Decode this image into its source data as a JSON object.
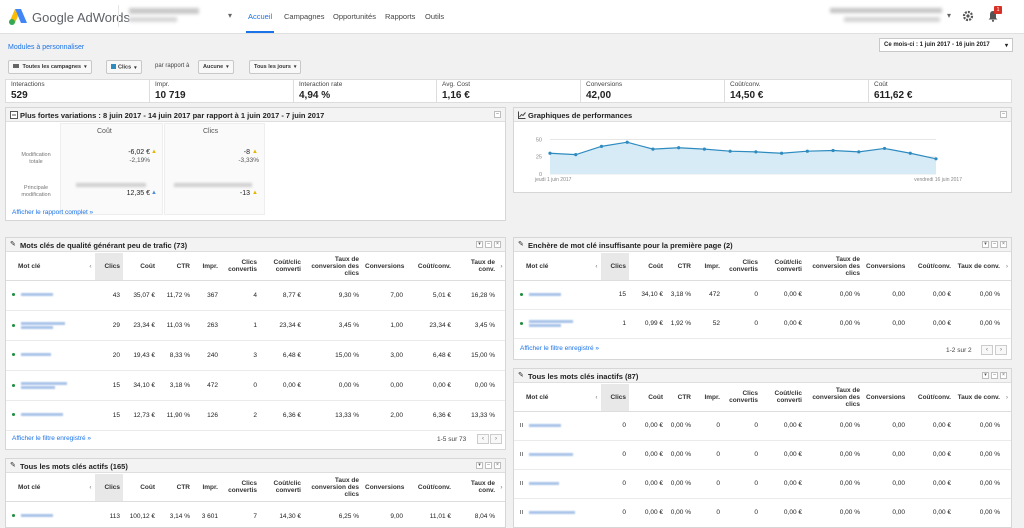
{
  "nav": {
    "brand": "Google AdWords",
    "tabs": [
      "Accueil",
      "Campagnes",
      "Opportunités",
      "Rapports",
      "Outils"
    ],
    "notification_count": "1"
  },
  "toolbar": {
    "modules_link": "Modules à personnaliser",
    "date_range": "Ce mois-ci : 1 juin 2017 - 16 juin 2017",
    "campaigns_filter": "Toutes les campagnes",
    "metric_filter": "Clics",
    "compare_label": "par rapport à",
    "compare_value": "Aucune",
    "days_filter": "Tous les jours"
  },
  "metrics": [
    {
      "label": "Interactions",
      "value": "529"
    },
    {
      "label": "Impr.",
      "value": "10 719"
    },
    {
      "label": "Interaction rate",
      "value": "4,94 %"
    },
    {
      "label": "Avg. Cost",
      "value": "1,16 €"
    },
    {
      "label": "Conversions",
      "value": "42,00"
    },
    {
      "label": "Coût/conv.",
      "value": "14,50 €"
    },
    {
      "label": "Coût",
      "value": "611,62 €"
    }
  ],
  "variations": {
    "title": "Plus fortes variations : 8 juin 2017 - 14 juin 2017 par rapport à 1 juin 2017 - 7 juin 2017",
    "col_cout": "Coût",
    "col_clics": "Clics",
    "row_total": "Modification totale",
    "row_main": "Principale modification",
    "cout_change": "-6,02 €",
    "cout_pct": "-2,19%",
    "clics_change": "-8",
    "clics_pct": "-3,33%",
    "cout_main": "12,35 €",
    "clics_main": "-13",
    "footer_link": "Afficher le rapport complet »"
  },
  "performance": {
    "title": "Graphiques de performances",
    "y_ticks": [
      "50",
      "25",
      "0"
    ],
    "x_start": "jeudi 1 juin 2017",
    "x_end": "vendredi 16 juin 2017"
  },
  "chart_data": {
    "type": "area",
    "title": "Graphiques de performances",
    "x": [
      "1 juin 2017",
      "2 juin 2017",
      "3 juin 2017",
      "4 juin 2017",
      "5 juin 2017",
      "6 juin 2017",
      "7 juin 2017",
      "8 juin 2017",
      "9 juin 2017",
      "10 juin 2017",
      "11 juin 2017",
      "12 juin 2017",
      "13 juin 2017",
      "14 juin 2017",
      "15 juin 2017",
      "16 juin 2017"
    ],
    "series": [
      {
        "values": [
          30,
          28,
          40,
          46,
          36,
          38,
          36,
          33,
          32,
          30,
          33,
          34,
          32,
          37,
          30,
          22
        ]
      }
    ],
    "ylim": [
      0,
      55
    ],
    "y_ticks": [
      0,
      25,
      50
    ],
    "grid": true
  },
  "table_headers": {
    "keyword": "Mot clé",
    "clics": "Clics",
    "cout": "Coût",
    "ctr": "CTR",
    "impr": "Impr.",
    "clics_convertis": "Clics convertis",
    "cout_clic_converti": "Coût/clic converti",
    "taux_conv_clics": "Taux de conversion des clics",
    "conversions": "Conversions",
    "cout_conv": "Coût/conv.",
    "taux_conv": "Taux de conv."
  },
  "quality": {
    "title": "Mots clés de qualité générant peu de trafic (73)",
    "rows": [
      [
        "43",
        "35,07 €",
        "11,72 %",
        "367",
        "4",
        "8,77 €",
        "9,30 %",
        "7,00",
        "5,01 €",
        "16,28 %"
      ],
      [
        "29",
        "23,34 €",
        "11,03 %",
        "263",
        "1",
        "23,34 €",
        "3,45 %",
        "1,00",
        "23,34 €",
        "3,45 %"
      ],
      [
        "20",
        "19,43 €",
        "8,33 %",
        "240",
        "3",
        "6,48 €",
        "15,00 %",
        "3,00",
        "6,48 €",
        "15,00 %"
      ],
      [
        "15",
        "34,10 €",
        "3,18 %",
        "472",
        "0",
        "0,00 €",
        "0,00 %",
        "0,00",
        "0,00 €",
        "0,00 %"
      ],
      [
        "15",
        "12,73 €",
        "11,90 %",
        "126",
        "2",
        "6,36 €",
        "13,33 %",
        "2,00",
        "6,36 €",
        "13,33 %"
      ]
    ],
    "footer_link": "Afficher le filtre enregistré »",
    "pager": "1-5 sur 73"
  },
  "active": {
    "title": "Tous les mots clés actifs (165)",
    "rows": [
      [
        "113",
        "100,12 €",
        "3,14 %",
        "3 601",
        "7",
        "14,30 €",
        "6,25 %",
        "9,00",
        "11,01 €",
        "8,04 %"
      ]
    ]
  },
  "bid": {
    "title": "Enchère de mot clé insuffisante pour la première page (2)",
    "rows": [
      [
        "15",
        "34,10 €",
        "3,18 %",
        "472",
        "0",
        "0,00 €",
        "0,00 %",
        "0,00",
        "0,00 €",
        "0,00 %"
      ],
      [
        "1",
        "0,99 €",
        "1,92 %",
        "52",
        "0",
        "0,00 €",
        "0,00 %",
        "0,00",
        "0,00 €",
        "0,00 %"
      ]
    ],
    "footer_link": "Afficher le filtre enregistré »",
    "pager": "1-2 sur 2"
  },
  "inactive": {
    "title": "Tous les mots clés inactifs (87)",
    "rows": [
      [
        "0",
        "0,00 €",
        "0,00 %",
        "0",
        "0",
        "0,00 €",
        "0,00 %",
        "0,00",
        "0,00 €",
        "0,00 %"
      ],
      [
        "0",
        "0,00 €",
        "0,00 %",
        "0",
        "0",
        "0,00 €",
        "0,00 %",
        "0,00",
        "0,00 €",
        "0,00 %"
      ],
      [
        "0",
        "0,00 €",
        "0,00 %",
        "0",
        "0",
        "0,00 €",
        "0,00 %",
        "0,00",
        "0,00 €",
        "0,00 %"
      ],
      [
        "0",
        "0,00 €",
        "0,00 %",
        "0",
        "0",
        "0,00 €",
        "0,00 %",
        "0,00",
        "0,00 €",
        "0,00 %"
      ]
    ]
  },
  "colors": {
    "accent": "#1a73e8",
    "chart_line": "#2e8bbf",
    "chart_fill": "#d7ebf7",
    "keyword_dot": "#1e8e3e"
  }
}
